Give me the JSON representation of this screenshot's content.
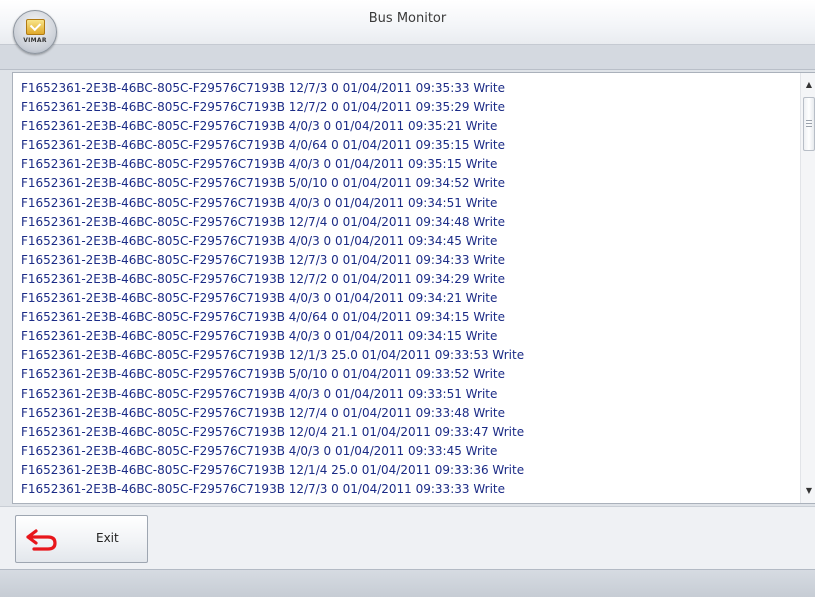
{
  "window": {
    "title": "Bus Monitor",
    "logo_text": "VIMAR"
  },
  "log": {
    "lines": [
      "F1652361-2E3B-46BC-805C-F29576C7193B 12/7/3 0 01/04/2011 09:35:33 Write",
      "F1652361-2E3B-46BC-805C-F29576C7193B 12/7/2 0 01/04/2011 09:35:29 Write",
      "F1652361-2E3B-46BC-805C-F29576C7193B 4/0/3 0 01/04/2011 09:35:21 Write",
      "F1652361-2E3B-46BC-805C-F29576C7193B 4/0/64 0 01/04/2011 09:35:15 Write",
      "F1652361-2E3B-46BC-805C-F29576C7193B 4/0/3 0 01/04/2011 09:35:15 Write",
      "F1652361-2E3B-46BC-805C-F29576C7193B 5/0/10 0 01/04/2011 09:34:52 Write",
      "F1652361-2E3B-46BC-805C-F29576C7193B 4/0/3 0 01/04/2011 09:34:51 Write",
      "F1652361-2E3B-46BC-805C-F29576C7193B 12/7/4 0 01/04/2011 09:34:48 Write",
      "F1652361-2E3B-46BC-805C-F29576C7193B 4/0/3 0 01/04/2011 09:34:45 Write",
      "F1652361-2E3B-46BC-805C-F29576C7193B 12/7/3 0 01/04/2011 09:34:33 Write",
      "F1652361-2E3B-46BC-805C-F29576C7193B 12/7/2 0 01/04/2011 09:34:29 Write",
      "F1652361-2E3B-46BC-805C-F29576C7193B 4/0/3 0 01/04/2011 09:34:21 Write",
      "F1652361-2E3B-46BC-805C-F29576C7193B 4/0/64 0 01/04/2011 09:34:15 Write",
      "F1652361-2E3B-46BC-805C-F29576C7193B 4/0/3 0 01/04/2011 09:34:15 Write",
      "F1652361-2E3B-46BC-805C-F29576C7193B 12/1/3 25.0 01/04/2011 09:33:53 Write",
      "F1652361-2E3B-46BC-805C-F29576C7193B 5/0/10 0 01/04/2011 09:33:52 Write",
      "F1652361-2E3B-46BC-805C-F29576C7193B 4/0/3 0 01/04/2011 09:33:51 Write",
      "F1652361-2E3B-46BC-805C-F29576C7193B 12/7/4 0 01/04/2011 09:33:48 Write",
      "F1652361-2E3B-46BC-805C-F29576C7193B 12/0/4 21.1 01/04/2011 09:33:47 Write",
      "F1652361-2E3B-46BC-805C-F29576C7193B 4/0/3 0 01/04/2011 09:33:45 Write",
      "F1652361-2E3B-46BC-805C-F29576C7193B 12/1/4 25.0 01/04/2011 09:33:36 Write",
      "F1652361-2E3B-46BC-805C-F29576C7193B 12/7/3 0 01/04/2011 09:33:33 Write"
    ]
  },
  "footer": {
    "exit_label": "Exit",
    "exit_icon": "return-arrow-icon"
  },
  "colors": {
    "log_text": "#1b2b86",
    "exit_arrow": "#e8161b"
  }
}
